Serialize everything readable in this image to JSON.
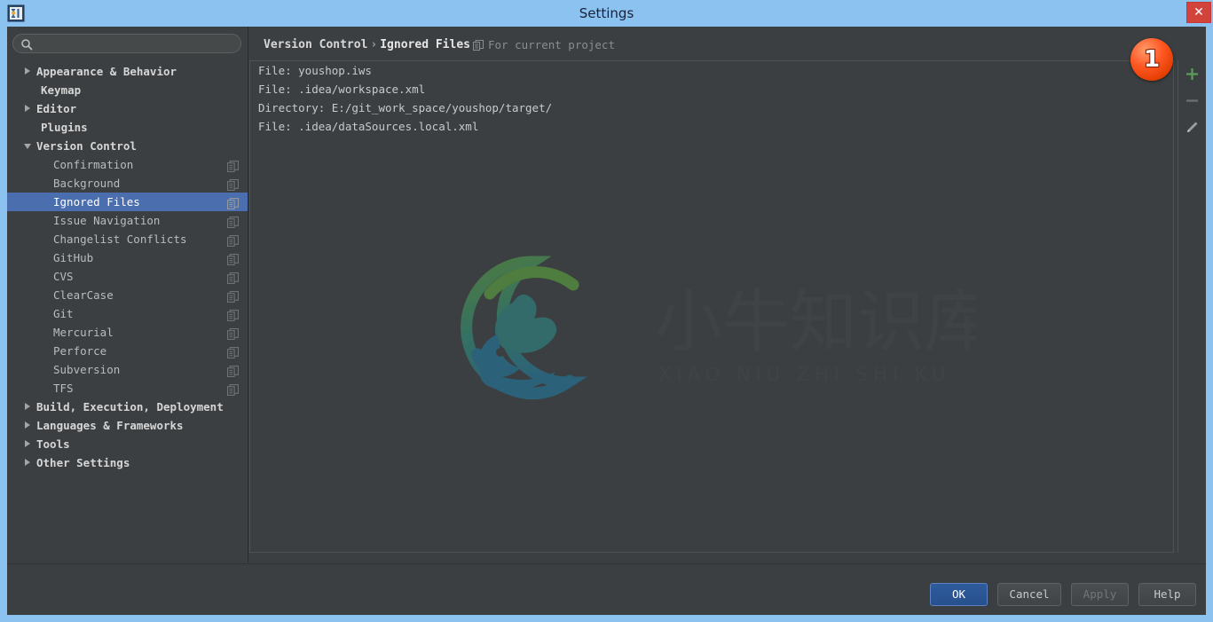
{
  "window": {
    "title": "Settings",
    "app_icon": "intellij-idea-logo",
    "close_label": "✕",
    "titlebar_color": "#8cc2f0",
    "close_color": "#d2433c"
  },
  "sidebar": {
    "search": {
      "value": "",
      "placeholder": "",
      "icon": "search-icon"
    },
    "items": [
      {
        "label": "Appearance & Behavior",
        "level": 0,
        "state": "collapsed",
        "icon": null,
        "selected": false
      },
      {
        "label": "Keymap",
        "level": 0,
        "state": "none",
        "icon": null,
        "selected": false
      },
      {
        "label": "Editor",
        "level": 0,
        "state": "collapsed",
        "icon": null,
        "selected": false
      },
      {
        "label": "Plugins",
        "level": 0,
        "state": "none",
        "icon": null,
        "selected": false
      },
      {
        "label": "Version Control",
        "level": 0,
        "state": "expanded",
        "icon": null,
        "selected": false
      },
      {
        "label": "Confirmation",
        "level": 1,
        "state": "none",
        "icon": "project-scope-icon",
        "selected": false
      },
      {
        "label": "Background",
        "level": 1,
        "state": "none",
        "icon": "project-scope-icon",
        "selected": false
      },
      {
        "label": "Ignored Files",
        "level": 1,
        "state": "none",
        "icon": "project-scope-icon",
        "selected": true
      },
      {
        "label": "Issue Navigation",
        "level": 1,
        "state": "none",
        "icon": "project-scope-icon",
        "selected": false
      },
      {
        "label": "Changelist Conflicts",
        "level": 1,
        "state": "none",
        "icon": "project-scope-icon",
        "selected": false
      },
      {
        "label": "GitHub",
        "level": 1,
        "state": "none",
        "icon": "project-scope-icon",
        "selected": false
      },
      {
        "label": "CVS",
        "level": 1,
        "state": "none",
        "icon": "project-scope-icon",
        "selected": false
      },
      {
        "label": "ClearCase",
        "level": 1,
        "state": "none",
        "icon": "project-scope-icon",
        "selected": false
      },
      {
        "label": "Git",
        "level": 1,
        "state": "none",
        "icon": "project-scope-icon",
        "selected": false
      },
      {
        "label": "Mercurial",
        "level": 1,
        "state": "none",
        "icon": "project-scope-icon",
        "selected": false
      },
      {
        "label": "Perforce",
        "level": 1,
        "state": "none",
        "icon": "project-scope-icon",
        "selected": false
      },
      {
        "label": "Subversion",
        "level": 1,
        "state": "none",
        "icon": "project-scope-icon",
        "selected": false
      },
      {
        "label": "TFS",
        "level": 1,
        "state": "none",
        "icon": "project-scope-icon",
        "selected": false
      },
      {
        "label": "Build, Execution, Deployment",
        "level": 0,
        "state": "collapsed",
        "icon": null,
        "selected": false
      },
      {
        "label": "Languages & Frameworks",
        "level": 0,
        "state": "collapsed",
        "icon": null,
        "selected": false
      },
      {
        "label": "Tools",
        "level": 0,
        "state": "collapsed",
        "icon": null,
        "selected": false
      },
      {
        "label": "Other Settings",
        "level": 0,
        "state": "collapsed",
        "icon": null,
        "selected": false
      }
    ],
    "selection_color": "#4b6eaf"
  },
  "content": {
    "breadcrumb": {
      "parent": "Version Control",
      "separator": "›",
      "current": "Ignored Files"
    },
    "scope": {
      "icon": "project-scope-icon",
      "label": "For current project"
    },
    "ignored_files": [
      "File: youshop.iws",
      "File: .idea/workspace.xml",
      "Directory: E:/git_work_space/youshop/target/",
      "File: .idea/dataSources.local.xml"
    ],
    "toolbar": [
      {
        "name": "add-icon",
        "glyph": "+",
        "enabled": true,
        "color": "#5a9e5a"
      },
      {
        "name": "remove-icon",
        "glyph": "−",
        "enabled": false,
        "color": "#6e7173"
      },
      {
        "name": "edit-pencil-icon",
        "glyph": "✎",
        "enabled": true,
        "color": "#9a9d9f"
      }
    ],
    "watermark": {
      "text_cn": "小牛知识库",
      "text_pinyin": "XIAO NIU ZHI SHI KU",
      "logo": "bull-circle-logo",
      "color_start": "#5fae3f",
      "color_end": "#1f7fa8"
    }
  },
  "annotations": [
    {
      "label": "1",
      "color": "#ff5722"
    }
  ],
  "buttons": {
    "ok": "OK",
    "cancel": "Cancel",
    "apply": "Apply",
    "help": "Help",
    "apply_enabled": false,
    "ok_default": true
  }
}
